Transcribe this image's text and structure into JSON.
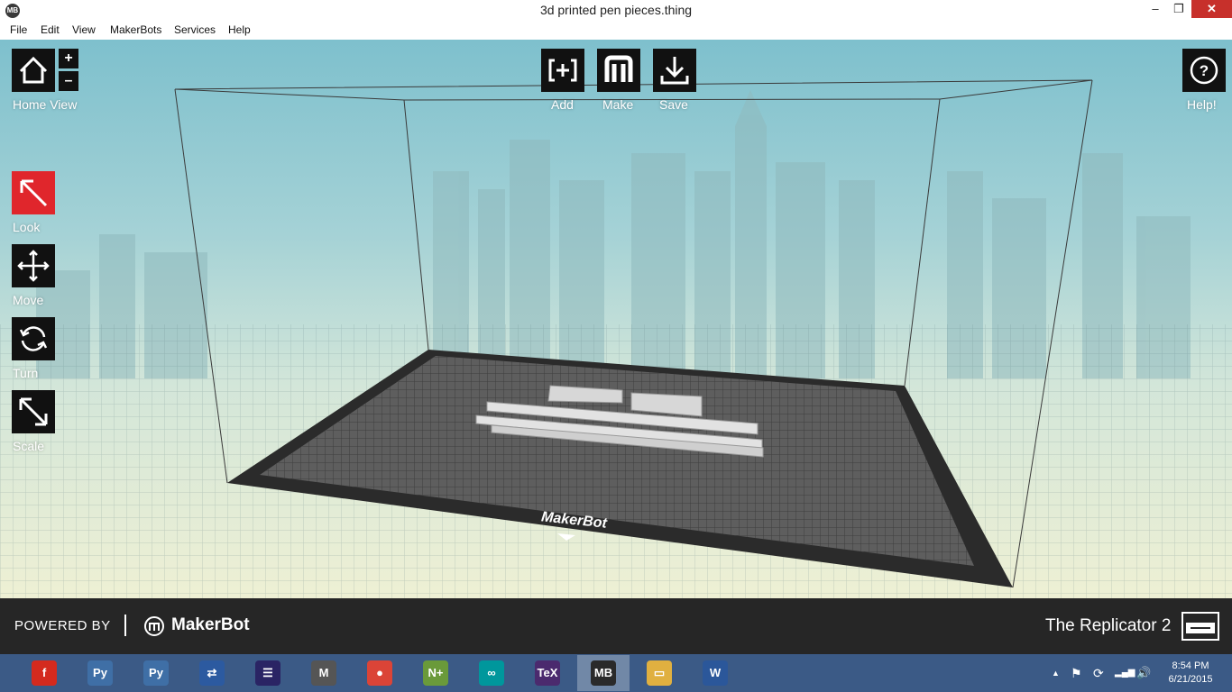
{
  "window": {
    "title": "3d printed pen pieces.thing",
    "app_icon": "MB",
    "controls": {
      "minimize": "–",
      "maximize": "❐",
      "close": "✕"
    }
  },
  "menu": [
    "File",
    "Edit",
    "View",
    "MakerBots",
    "Services",
    "Help"
  ],
  "toolbar": {
    "home_label": "Home View",
    "zoom_in": "+",
    "zoom_out": "–",
    "add_label": "Add",
    "make_label": "Make",
    "save_label": "Save",
    "help_label": "Help!"
  },
  "tools": {
    "look_label": "Look",
    "move_label": "Move",
    "turn_label": "Turn",
    "scale_label": "Scale",
    "active": "look"
  },
  "build_plate": {
    "brand": "MakerBot"
  },
  "footer": {
    "powered_by": "POWERED BY",
    "brand": "MakerBot",
    "printer": "The Replicator 2"
  },
  "taskbar": {
    "apps": [
      {
        "icon": "flash-icon",
        "glyph": "f",
        "color": "#d42a1e"
      },
      {
        "icon": "python-icon",
        "glyph": "Py",
        "color": "#3f6fa6"
      },
      {
        "icon": "python-idle-icon",
        "glyph": "Py",
        "color": "#3f6fa6"
      },
      {
        "icon": "network-app-icon",
        "glyph": "⇄",
        "color": "#2c5aa0"
      },
      {
        "icon": "eclipse-icon",
        "glyph": "☰",
        "color": "#2a2464"
      },
      {
        "icon": "makerware-icon",
        "glyph": "M",
        "color": "#555555"
      },
      {
        "icon": "chrome-icon",
        "glyph": "●",
        "color": "#db4437"
      },
      {
        "icon": "notepad-plus-icon",
        "glyph": "N+",
        "color": "#6a9a3a"
      },
      {
        "icon": "arduino-icon",
        "glyph": "∞",
        "color": "#00979c"
      },
      {
        "icon": "tex-icon",
        "glyph": "TeX",
        "color": "#4b2a6e"
      },
      {
        "icon": "makerbot-desktop-icon",
        "glyph": "MB",
        "color": "#2a2a2a"
      },
      {
        "icon": "file-explorer-icon",
        "glyph": "▭",
        "color": "#e0b040"
      },
      {
        "icon": "word-icon",
        "glyph": "W",
        "color": "#2b579a"
      }
    ],
    "active_index": 10,
    "tray": {
      "up_arrow": "▲",
      "flag": "⚑",
      "sync": "⟳",
      "signal": "▂▄▆",
      "volume": "🔊"
    },
    "time": "8:54 PM",
    "date": "6/21/2015"
  }
}
